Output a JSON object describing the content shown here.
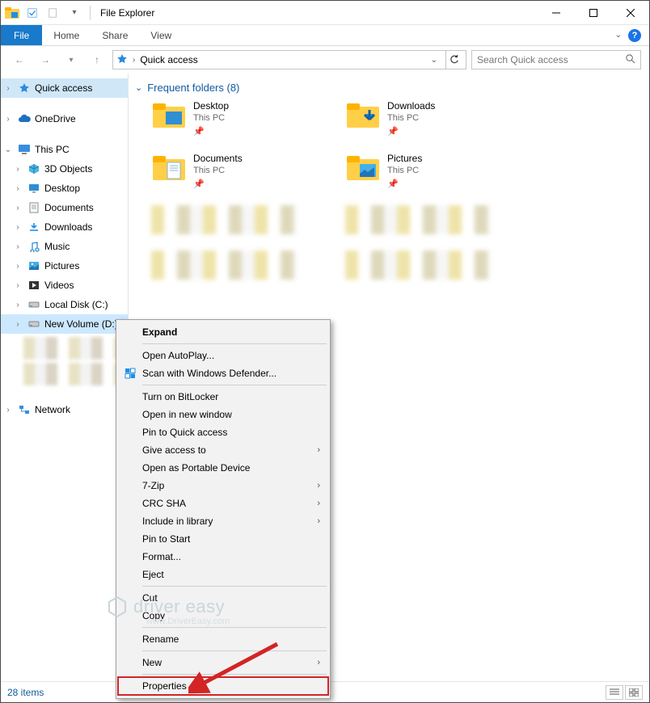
{
  "titlebar": {
    "title": "File Explorer"
  },
  "ribbon": {
    "file": "File",
    "tabs": [
      "Home",
      "Share",
      "View"
    ]
  },
  "address": {
    "path": "Quick access",
    "search_placeholder": "Search Quick access"
  },
  "tree": {
    "quick_access": "Quick access",
    "onedrive": "OneDrive",
    "this_pc": "This PC",
    "children": [
      "3D Objects",
      "Desktop",
      "Documents",
      "Downloads",
      "Music",
      "Pictures",
      "Videos",
      "Local Disk (C:)",
      "New Volume (D:)"
    ],
    "network": "Network"
  },
  "section": {
    "title": "Frequent folders (8)"
  },
  "folders": [
    {
      "name": "Desktop",
      "sub": "This PC"
    },
    {
      "name": "Downloads",
      "sub": "This PC"
    },
    {
      "name": "Documents",
      "sub": "This PC"
    },
    {
      "name": "Pictures",
      "sub": "This PC"
    }
  ],
  "status": {
    "text": "28 items"
  },
  "ctx": {
    "expand": "Expand",
    "open_autoplay": "Open AutoPlay...",
    "scan_defender": "Scan with Windows Defender...",
    "bitlocker": "Turn on BitLocker",
    "new_window": "Open in new window",
    "pin_quick": "Pin to Quick access",
    "give_access": "Give access to",
    "portable": "Open as Portable Device",
    "seven_zip": "7-Zip",
    "crc_sha": "CRC SHA",
    "include_lib": "Include in library",
    "pin_start": "Pin to Start",
    "format": "Format...",
    "eject": "Eject",
    "cut": "Cut",
    "copy": "Copy",
    "rename": "Rename",
    "new": "New",
    "properties": "Properties"
  },
  "watermark": {
    "brand": "driver easy",
    "url": "www.DriverEasy.com"
  }
}
